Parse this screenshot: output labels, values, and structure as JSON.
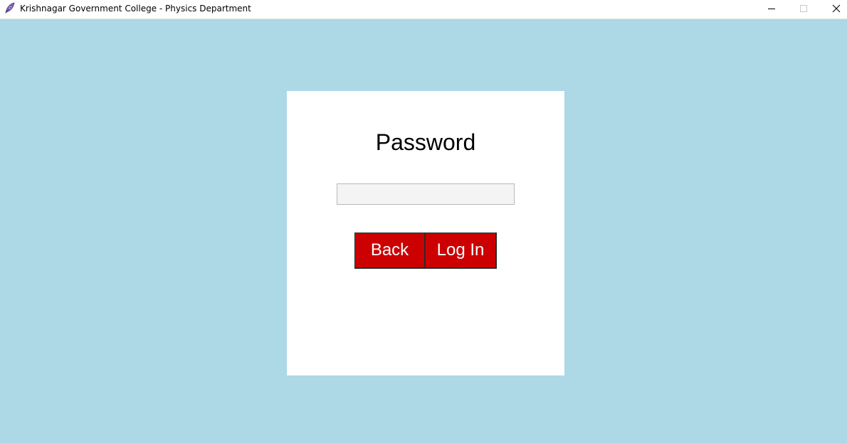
{
  "window": {
    "title": "Krishnagar Government College - Physics Department",
    "background_color": "#add8e6",
    "controls": {
      "minimize_icon": "minimize-icon",
      "maximize_icon": "maximize-icon",
      "close_icon": "close-icon"
    }
  },
  "login_card": {
    "title": "Password",
    "password_input": {
      "value": "",
      "placeholder": ""
    },
    "back_label": "Back",
    "login_label": "Log In",
    "button_color": "#cc0000"
  }
}
